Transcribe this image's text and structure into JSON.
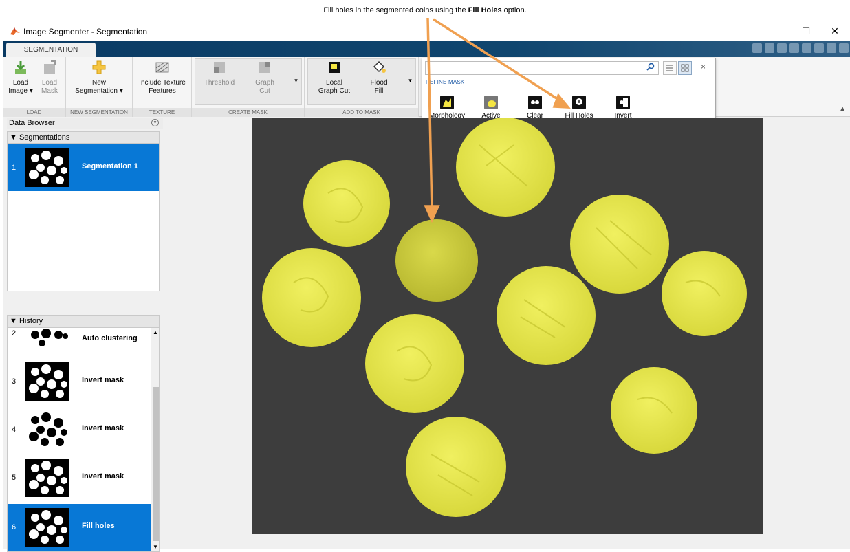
{
  "caption": {
    "prefix": "Fill holes in the segmented coins using the",
    "emphasis": "Fill Holes",
    "suffix": "option."
  },
  "window": {
    "title": "Image Segmenter - Segmentation",
    "controls": {
      "minimize": "–",
      "maximize": "☐",
      "close": "✕"
    }
  },
  "ribbon": {
    "tab": "SEGMENTATION",
    "sections": {
      "load": {
        "label": "LOAD",
        "load_image": "Load\nImage ▾",
        "load_mask": "Load\nMask"
      },
      "new_segmentation": {
        "label": "NEW SEGMENTATION",
        "new_segmentation": "New\nSegmentation ▾"
      },
      "texture": {
        "label": "TEXTURE",
        "include_texture": "Include Texture\nFeatures"
      },
      "create_mask": {
        "label": "CREATE MASK",
        "threshold": "Threshold",
        "graph_cut": "Graph\nCut"
      },
      "add_to_mask": {
        "label": "ADD TO MASK",
        "local_graph_cut": "Local\nGraph Cut",
        "flood_fill": "Flood\nFill"
      }
    }
  },
  "gallery": {
    "search_placeholder": "",
    "header": "REFINE MASK",
    "items": [
      {
        "label": "Morphology",
        "icon": "morphology-icon"
      },
      {
        "label": "Active\nContours",
        "icon": "active-contours-icon"
      },
      {
        "label": "Clear\nBorders",
        "icon": "clear-borders-icon"
      },
      {
        "label": "Fill Holes",
        "icon": "fill-holes-icon"
      },
      {
        "label": "Invert\nMask",
        "icon": "invert-mask-icon"
      }
    ],
    "close": "×"
  },
  "data_browser": {
    "title": "Data Browser",
    "segmentations_header": "Segmentations",
    "segmentations": [
      {
        "num": "1",
        "label": "Segmentation 1",
        "selected": true
      }
    ],
    "history_header": "History",
    "history": [
      {
        "num": "2",
        "label": "Auto clustering",
        "thumb": "inverted",
        "selected": false
      },
      {
        "num": "3",
        "label": "Invert mask",
        "thumb": "normal",
        "selected": false
      },
      {
        "num": "4",
        "label": "Invert mask",
        "thumb": "inverted",
        "selected": false
      },
      {
        "num": "5",
        "label": "Invert mask",
        "thumb": "normal",
        "selected": false
      },
      {
        "num": "6",
        "label": "Fill holes",
        "thumb": "normal",
        "selected": true
      }
    ]
  },
  "colors": {
    "accent": "#0878d6",
    "arrow": "#f0a050",
    "mask": "#e8e84a",
    "background": "#3d3d3d"
  }
}
